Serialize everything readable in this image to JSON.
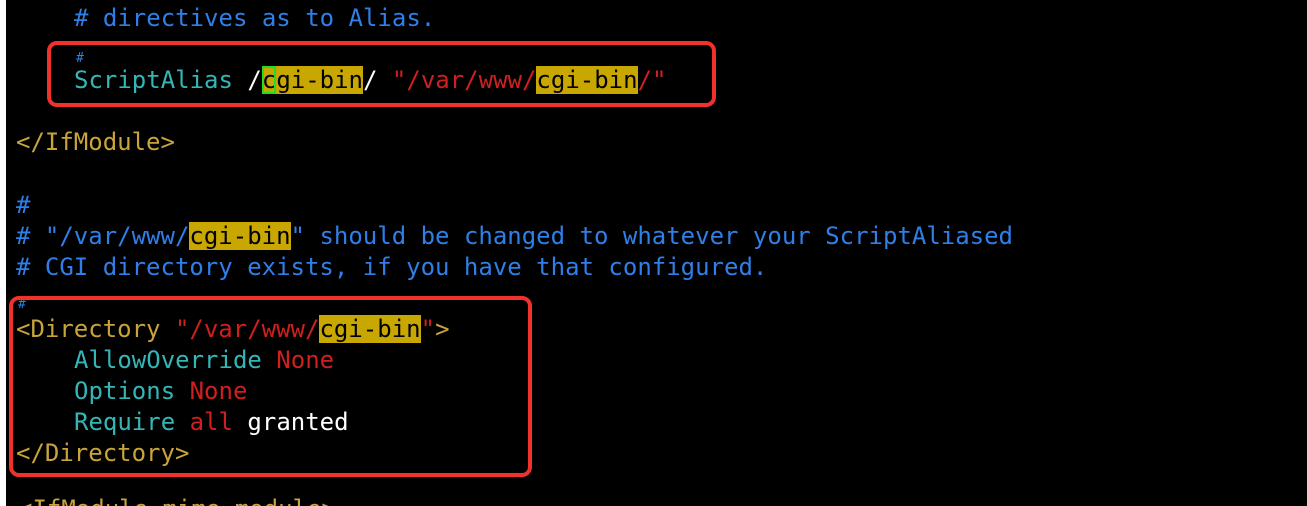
{
  "editor": {
    "lines": {
      "l1": {
        "text": "# directives as to Alias."
      },
      "l2": {
        "text": "#"
      },
      "l3": {
        "directive": "ScriptAlias",
        "url_prefix": " /",
        "cursor_char": "c",
        "url_hl": "gi-bin",
        "url_suffix": "/",
        "space": " ",
        "path_prefix": "\"/var/www/",
        "path_hl": "cgi-bin",
        "path_suffix": "/\""
      },
      "l4": {
        "text": "</IfModule>"
      },
      "l5": {
        "text": "#"
      },
      "l6": {
        "prefix": "# \"/var/www/",
        "hl": "cgi-bin",
        "suffix": "\" should be changed to whatever your ScriptAliased"
      },
      "l7": {
        "text": "# CGI directory exists, if you have that configured."
      },
      "l8": {
        "text": "#"
      },
      "l9": {
        "open": "<Directory",
        "space": " ",
        "path_prefix": "\"/var/www/",
        "path_hl": "cgi-bin",
        "path_suffix": "\"",
        "close": ">"
      },
      "l10": {
        "directive": "AllowOverride",
        "value": "None"
      },
      "l11": {
        "directive": "Options",
        "value": "None"
      },
      "l12": {
        "directive": "Require",
        "arg1": "all",
        "arg2": "granted"
      },
      "l13": {
        "text": "</Directory>"
      },
      "l14": {
        "text": "<IfModule mime_module>"
      }
    },
    "search_term": "cgi-bin"
  },
  "colors": {
    "background": "#000000",
    "comment": "#2f7fe8",
    "directive": "#35b6b6",
    "tag": "#c8a43a",
    "string": "#d01f1f",
    "search_highlight": "#c8a800",
    "cursor": "#22dd22",
    "annotation_box": "#f0322a"
  }
}
